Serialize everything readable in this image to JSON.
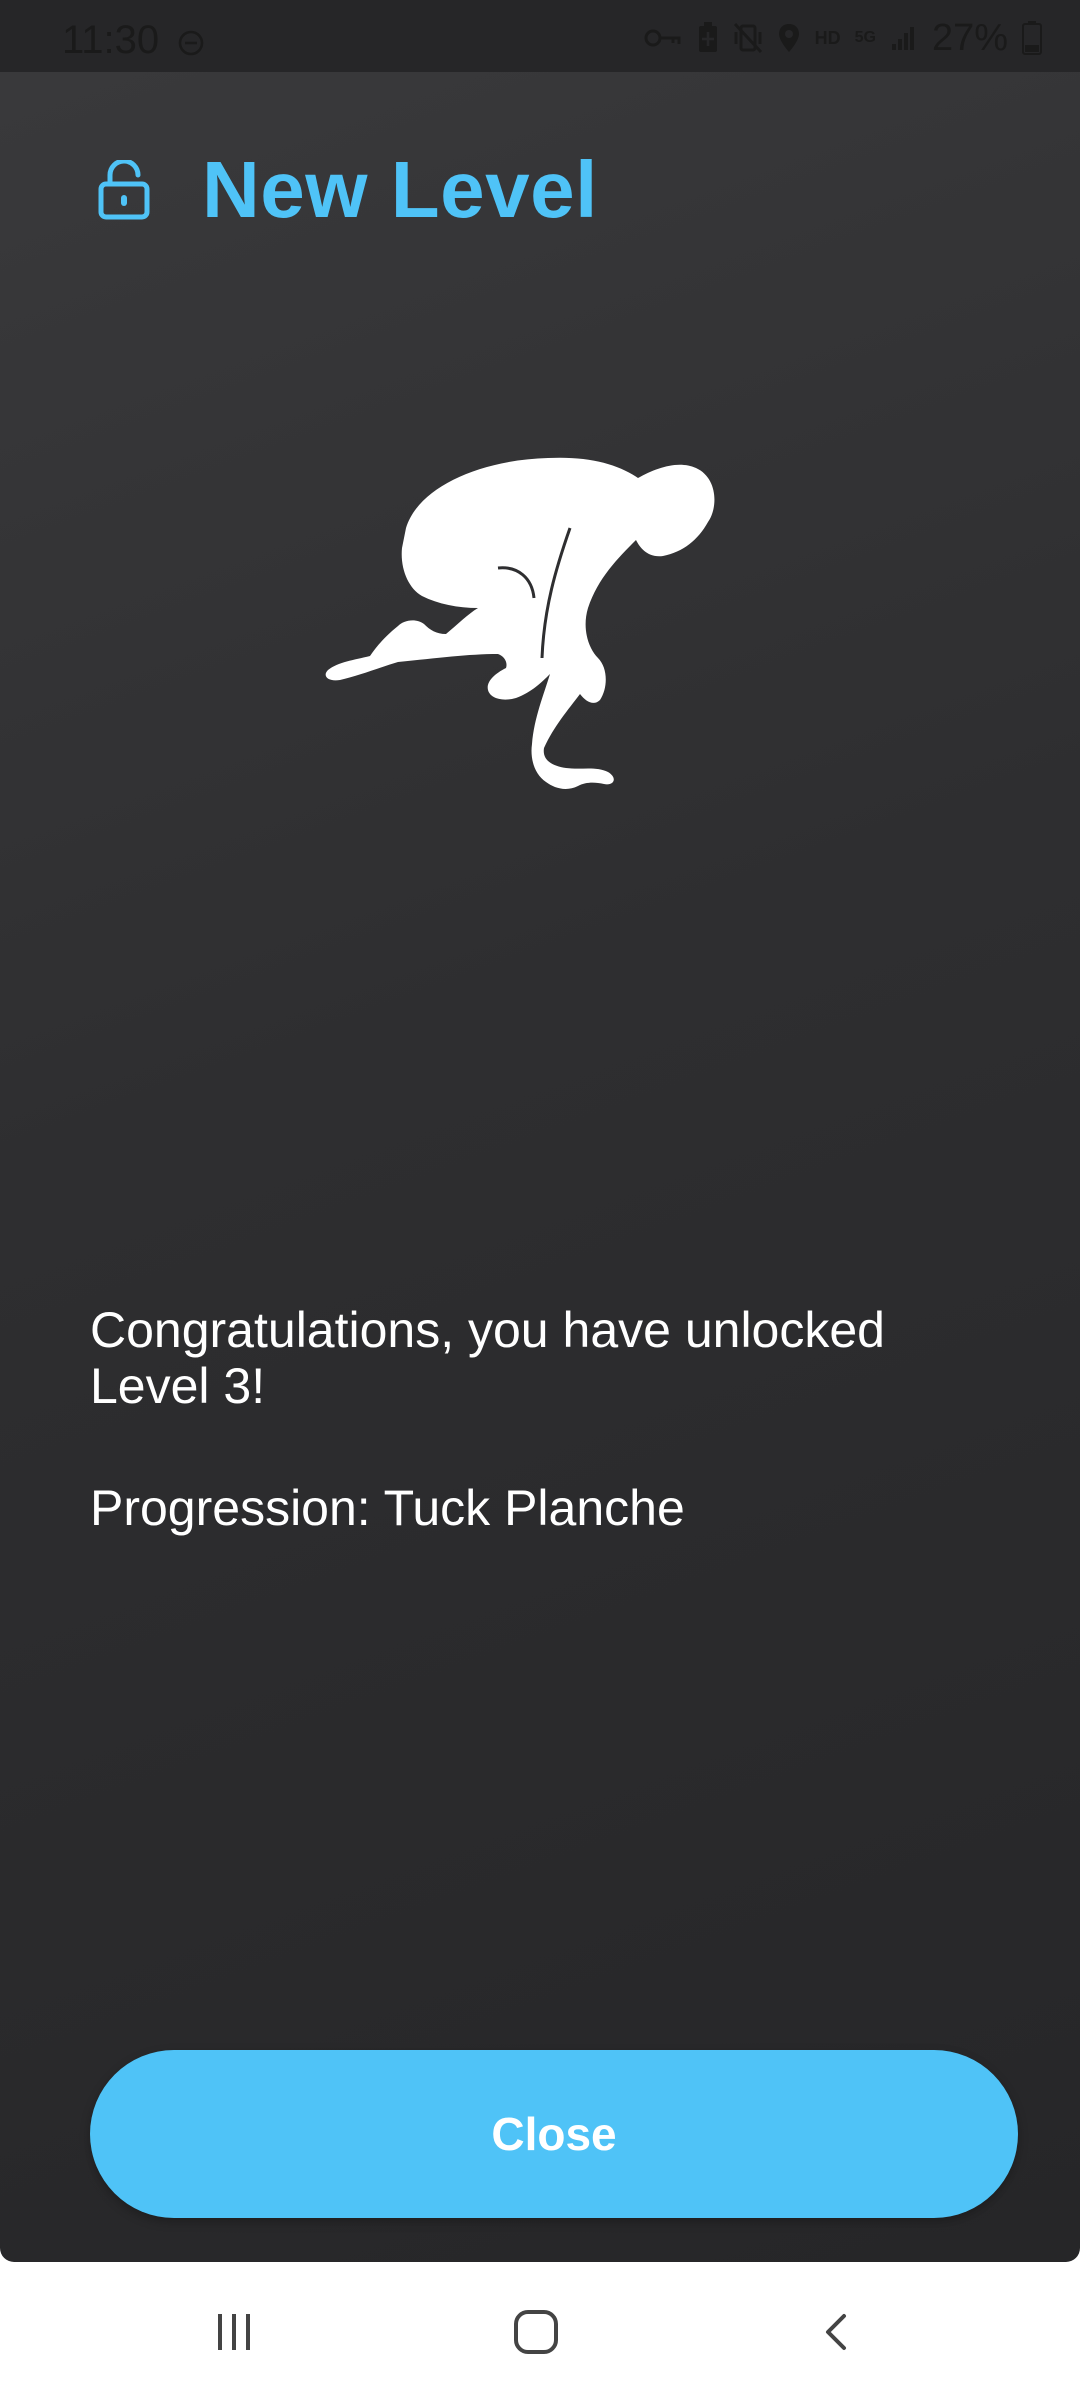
{
  "status_bar": {
    "time": "11:30",
    "battery_percent": "27%",
    "icons": [
      "do-not-disturb-icon",
      "key-icon",
      "battery-saver-icon",
      "vibrate-icon",
      "location-icon",
      "hd-icon",
      "5g-icon",
      "signal-icon",
      "battery-icon"
    ],
    "hd_label": "HD",
    "network_label": "5G"
  },
  "header": {
    "title": "New Level",
    "icon": "lock-open-icon"
  },
  "illustration": {
    "icon": "crow-pose-figure"
  },
  "message": {
    "congrats": "Congratulations, you have unlocked Level 3!",
    "progression": "Progression: Tuck Planche"
  },
  "close_button": {
    "label": "Close"
  },
  "nav_bar": {
    "icons": [
      "recent-apps-icon",
      "home-icon",
      "back-icon"
    ]
  },
  "colors": {
    "accent": "#4fc3f7",
    "background": "#2e2e30",
    "text": "#ffffff"
  }
}
